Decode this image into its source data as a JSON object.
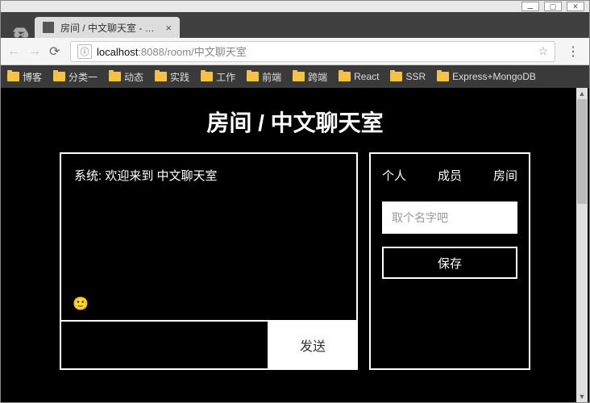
{
  "window": {
    "tab_title": "房间 / 中文聊天室 - Nod",
    "minimize": "⚊",
    "maximize": "▢",
    "close": "✕"
  },
  "addr": {
    "info": "ⓘ",
    "host": "localhost",
    "port": ":8088",
    "path": "/room/中文聊天室",
    "back": "←",
    "forward": "→",
    "reload": "⟳",
    "star": "☆",
    "menu": "⋮"
  },
  "bookmarks": [
    "博客",
    "分类一",
    "动态",
    "实践",
    "工作",
    "前端",
    "跨端",
    "React",
    "SSR",
    "Express+MongoDB"
  ],
  "room": {
    "title": "房间 / 中文聊天室",
    "system_msg": "系统: 欢迎来到 中文聊天室",
    "emoji": "🙂",
    "send": "发送",
    "input_value": ""
  },
  "side": {
    "tabs": [
      "个人",
      "成员",
      "房间"
    ],
    "name_placeholder": "取个名字吧",
    "save": "保存"
  }
}
